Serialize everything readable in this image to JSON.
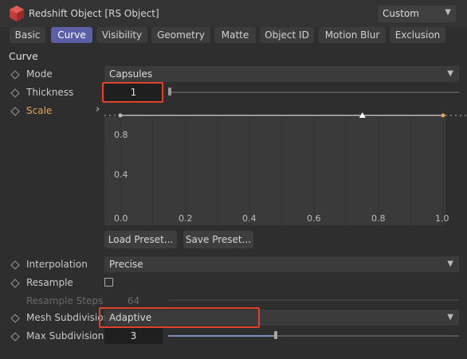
{
  "header": {
    "title": "Redshift Object [RS Object]",
    "preset": "Custom"
  },
  "tabs": [
    "Basic",
    "Curve",
    "Visibility",
    "Geometry",
    "Matte",
    "Object ID",
    "Motion Blur",
    "Exclusion"
  ],
  "section_title": "Curve",
  "mode": {
    "label": "Mode",
    "value": "Capsules"
  },
  "thickness": {
    "label": "Thickness",
    "value": "1",
    "slider_fraction": 0.0
  },
  "scale": {
    "label": "Scale",
    "expand": "›"
  },
  "curve": {
    "x_ticks": [
      "0.0",
      "0.2",
      "0.4",
      "0.6",
      "0.8",
      "1.0"
    ],
    "y_ticks": [
      "0.8",
      "0.4"
    ],
    "points": [
      {
        "x": 0.0,
        "y": 1.0
      },
      {
        "x": 0.75,
        "y": 1.0
      },
      {
        "x": 1.0,
        "y": 1.0
      }
    ]
  },
  "buttons": {
    "load_preset": "Load Preset...",
    "save_preset": "Save Preset..."
  },
  "interpolation": {
    "label": "Interpolation",
    "value": "Precise"
  },
  "resample": {
    "label": "Resample",
    "checked": false
  },
  "resample_steps": {
    "label": "Resample Steps",
    "value": "64"
  },
  "mesh_subdivision": {
    "label": "Mesh Subdivision",
    "value": "Adaptive"
  },
  "max_subdivisions": {
    "label": "Max Subdivisions",
    "value": "3",
    "slider_fraction": 0.37
  },
  "colors": {
    "accent_tab": "#5a5fa7",
    "highlight": "#e0432a",
    "scale_label": "#e8a35b",
    "logo": "#c33b3b"
  }
}
